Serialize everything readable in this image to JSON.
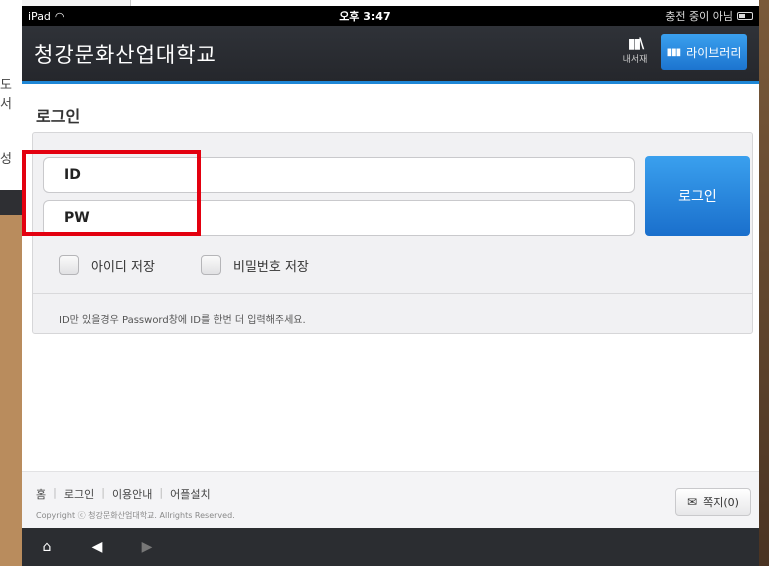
{
  "background": {
    "left_peek_texts": [
      "도서",
      "성"
    ]
  },
  "statusbar": {
    "device": "iPad",
    "time": "오후 3:47",
    "charging": "충전 중이 아님"
  },
  "header": {
    "title": "청강문화산업대학교",
    "shelf_label": "내서재",
    "library_label": "라이브러리"
  },
  "login": {
    "section_title": "로그인",
    "id_label": "ID",
    "pw_label": "PW",
    "button_label": "로그인",
    "save_id_label": "아이디 저장",
    "save_pw_label": "비밀번호 저장",
    "notice": "ID만 있을경우 Password창에 ID를 한번 더 입력해주세요."
  },
  "footer": {
    "links": [
      "홈",
      "로그인",
      "이용안내",
      "어플설치"
    ],
    "copyright": "Copyright ⓒ 청강문화산업대학교. Allrights Reserved.",
    "memo_label": "쪽지(0)"
  },
  "colors": {
    "accent": "#1e87d6",
    "header_bg": "#2f3238",
    "highlight": "#e3000f"
  },
  "icons": {
    "home": "home-icon",
    "back": "back-arrow-icon",
    "forward": "forward-arrow-icon",
    "shelf": "bookshelf-icon",
    "library": "library-icon",
    "memo": "memo-icon",
    "wifi": "wifi-icon",
    "battery": "battery-icon"
  }
}
